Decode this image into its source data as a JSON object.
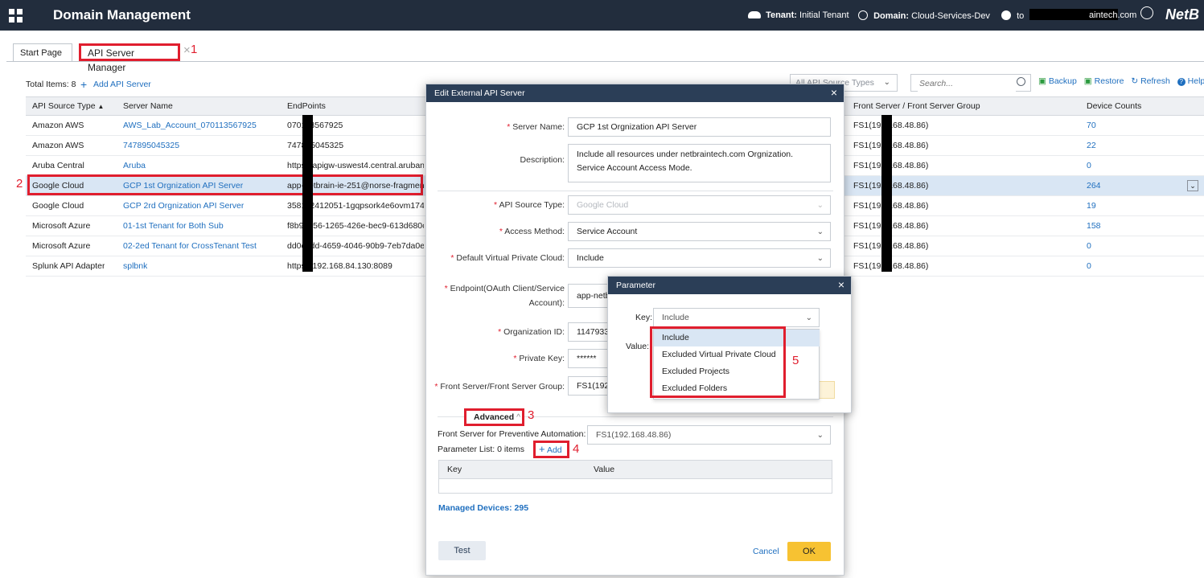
{
  "header": {
    "title": "Domain Management",
    "tenant_label": "Tenant:",
    "tenant_value": "Initial Tenant",
    "domain_label": "Domain:",
    "domain_value": "Cloud-Services-Dev",
    "user_prefix": "to",
    "user_suffix": "aintech.com",
    "logo": "NetB"
  },
  "tabs": [
    {
      "label": "Start Page"
    },
    {
      "label": "API Server Manager"
    }
  ],
  "annotations": [
    "1",
    "2",
    "3",
    "4",
    "5"
  ],
  "toolbar": {
    "total_items": "Total Items: 8",
    "add_server": "Add API Server",
    "source_filter": "All API Source Types",
    "search_placeholder": "Search...",
    "backup": "Backup",
    "restore": "Restore",
    "refresh": "Refresh",
    "help": "Help"
  },
  "table": {
    "columns": [
      "API Source Type",
      "Server Name",
      "EndPoints",
      "Front Server / Front Server Group",
      "Device Counts"
    ],
    "rows": [
      {
        "type": "Amazon AWS",
        "name": "AWS_Lab_Account_070113567925",
        "endpoint": "070113567925",
        "front": "FS1(192.168.48.86)",
        "count": "70"
      },
      {
        "type": "Amazon AWS",
        "name": "747895045325",
        "endpoint": "747895045325",
        "front": "FS1(192.168.48.86)",
        "count": "22"
      },
      {
        "type": "Aruba Central",
        "name": "Aruba",
        "endpoint": "https://apigw-uswest4.central.arubanetworks.com",
        "front": "FS1(192.168.48.86)",
        "count": "0"
      },
      {
        "type": "Google Cloud",
        "name": "GCP 1st Orgnization API Server",
        "endpoint": "app-netbrain-ie-251@norse-fragment",
        "front": "FS1(192.168.48.86)",
        "count": "264"
      },
      {
        "type": "Google Cloud",
        "name": "GCP 2rd Orgnization API Server",
        "endpoint": "358112412051-1gqpsork4e6ovm1747t",
        "front": "FS1(192.168.48.86)",
        "count": "19"
      },
      {
        "type": "Microsoft Azure",
        "name": "01-1st Tenant for Both Sub",
        "endpoint": "f8b9d156-1265-426e-bec9-613d680c89",
        "front": "FS1(192.168.48.86)",
        "count": "158"
      },
      {
        "type": "Microsoft Azure",
        "name": "02-2ed Tenant for CrossTenant Test",
        "endpoint": "dd0c0dd-4659-4046-90b9-7eb7da0e0",
        "front": "FS1(192.168.48.86)",
        "count": "0"
      },
      {
        "type": "Splunk API Adapter",
        "name": "splbnk",
        "endpoint": "https://192.168.84.130:8089",
        "front": "FS1(192.168.48.86)",
        "count": "0"
      }
    ]
  },
  "modal": {
    "title": "Edit External API Server",
    "server_name_label": "Server Name:",
    "server_name_value": "GCP 1st Orgnization API Server",
    "description_label": "Description:",
    "description_value": "Include all resources under netbraintech.com Orgnization. Service Account Access Mode.",
    "api_source_label": "API Source Type:",
    "api_source_value": "Google Cloud",
    "access_method_label": "Access Method:",
    "access_method_value": "Service Account",
    "vpc_label": "Default Virtual Private Cloud:",
    "vpc_value": "Include",
    "endpoint_label": "Endpoint(OAuth Client/Service Account):",
    "endpoint_value": "app-netbr",
    "org_id_label": "Organization ID:",
    "org_id_value": "11479334",
    "private_key_label": "Private Key:",
    "private_key_value": "******",
    "front_server_label": "Front Server/Front Server Group:",
    "front_server_value": "FS1(192.1",
    "advanced_label": "Advanced",
    "preventive_label": "Front Server for Preventive Automation:",
    "preventive_value": "FS1(192.168.48.86)",
    "param_list_label": "Parameter List: 0 items",
    "add_label": "Add",
    "param_key_header": "Key",
    "param_value_header": "Value",
    "managed_devices": "Managed Devices: 295",
    "test_label": "Test",
    "cancel_label": "Cancel",
    "ok_label": "OK"
  },
  "popup": {
    "title": "Parameter",
    "key_label": "Key:",
    "key_value": "Include",
    "value_label": "Value:",
    "options": [
      "Include",
      "Excluded Virtual Private Cloud",
      "Excluded Projects",
      "Excluded Folders"
    ]
  }
}
